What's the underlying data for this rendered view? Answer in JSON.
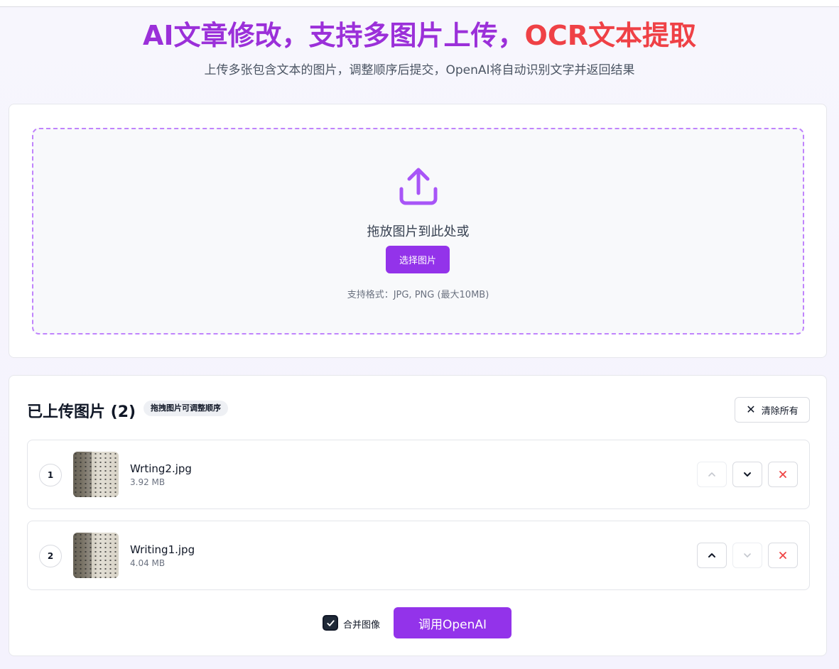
{
  "header": {
    "title_part1": "AI文章修改，支持多图片上传，",
    "title_part2": "OCR文本提取",
    "subtitle": "上传多张包含文本的图片，调整顺序后提交，OpenAI将自动识别文字并返回结果"
  },
  "upload": {
    "drop_text": "拖放图片到此处或",
    "choose_button": "选择图片",
    "formats": "支持格式：JPG, PNG (最大10MB)",
    "icon": "upload-icon"
  },
  "list": {
    "title": "已上传图片 (2)",
    "drag_hint": "拖拽图片可调整顺序",
    "clear_button": "清除所有",
    "items": [
      {
        "index": "1",
        "name": "Wrting2.jpg",
        "size": "3.92 MB"
      },
      {
        "index": "2",
        "name": "Writing1.jpg",
        "size": "4.04 MB"
      }
    ]
  },
  "actions": {
    "merge_label": "合并图像",
    "merge_checked": true,
    "call_button": "调用OpenAI"
  },
  "colors": {
    "accent_purple": "#9333ea",
    "title_purple": "#9b30d9",
    "title_red": "#ef4146",
    "delete_red": "#ef4444"
  }
}
